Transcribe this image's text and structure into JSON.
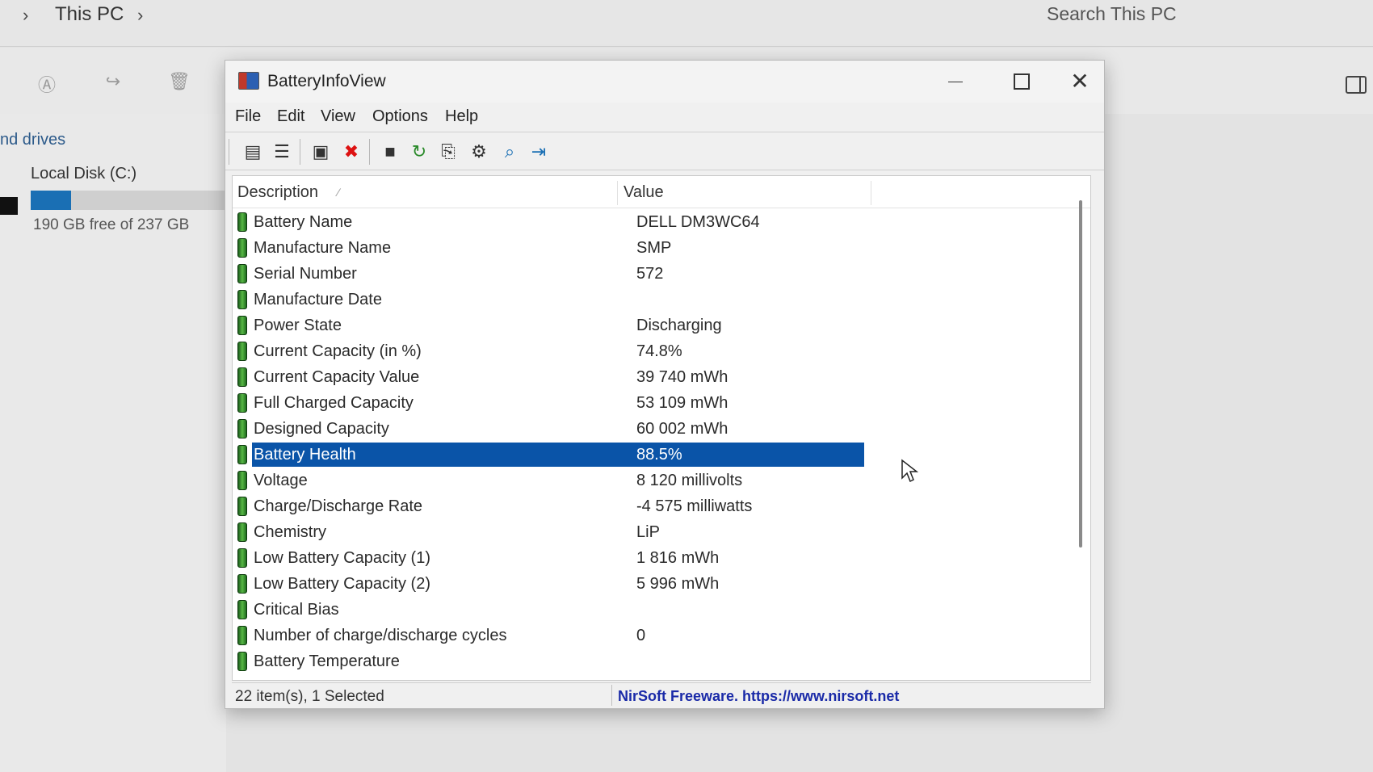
{
  "explorer": {
    "breadcrumb_location": "This PC",
    "search_placeholder": "Search This PC",
    "section_label": "nd drives",
    "disk": {
      "name": "Local Disk (C:)",
      "free_text": "190 GB free of 237 GB",
      "used_fraction": 0.2
    },
    "accent_color": "#1a6fb4"
  },
  "window": {
    "title": "BatteryInfoView",
    "menu": [
      "File",
      "Edit",
      "View",
      "Options",
      "Help"
    ],
    "toolbar_icons": [
      "properties-icon",
      "html-report-icon",
      "columns-icon",
      "delete-icon",
      "save-icon",
      "refresh-icon",
      "copy-icon",
      "options-icon",
      "find-icon",
      "exit-icon"
    ],
    "columns": {
      "description": "Description",
      "value": "Value"
    },
    "rows": [
      {
        "description": "Battery Name",
        "value": "DELL DM3WC64"
      },
      {
        "description": "Manufacture Name",
        "value": "SMP"
      },
      {
        "description": "Serial Number",
        "value": "572"
      },
      {
        "description": "Manufacture Date",
        "value": ""
      },
      {
        "description": "Power State",
        "value": "Discharging"
      },
      {
        "description": "Current Capacity (in %)",
        "value": "74.8%"
      },
      {
        "description": "Current Capacity Value",
        "value": "39 740 mWh"
      },
      {
        "description": "Full Charged Capacity",
        "value": "53 109 mWh"
      },
      {
        "description": "Designed Capacity",
        "value": "60 002 mWh"
      },
      {
        "description": "Battery Health",
        "value": "88.5%",
        "selected": true
      },
      {
        "description": "Voltage",
        "value": "8 120 millivolts"
      },
      {
        "description": "Charge/Discharge Rate",
        "value": "-4 575 milliwatts"
      },
      {
        "description": "Chemistry",
        "value": "LiP"
      },
      {
        "description": "Low Battery Capacity (1)",
        "value": "1 816 mWh"
      },
      {
        "description": "Low Battery Capacity (2)",
        "value": "5 996 mWh"
      },
      {
        "description": "Critical Bias",
        "value": ""
      },
      {
        "description": "Number of charge/discharge cycles",
        "value": "0"
      },
      {
        "description": "Battery Temperature",
        "value": ""
      }
    ],
    "status": {
      "count": "22 item(s), 1 Selected",
      "credit": "NirSoft Freeware. https://www.nirsoft.net"
    },
    "selection_color": "#0a54a8"
  }
}
